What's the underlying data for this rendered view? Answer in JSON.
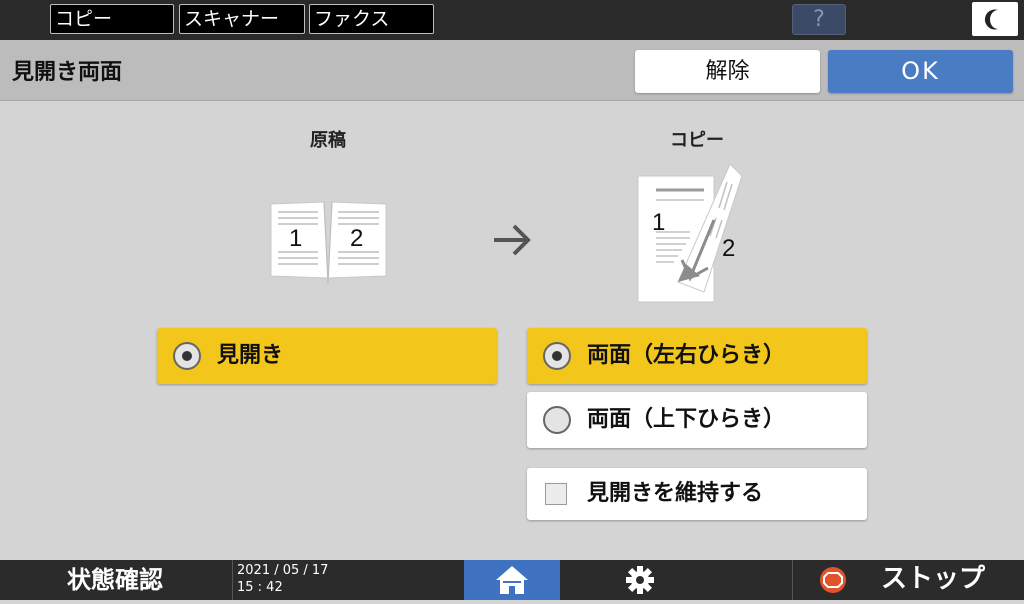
{
  "topbar": {
    "tabs": [
      {
        "label": "コピー"
      },
      {
        "label": "スキャナー"
      },
      {
        "label": "ファクス"
      }
    ],
    "help_label": "?"
  },
  "header": {
    "title": "見開き両面",
    "cancel_label": "解除",
    "ok_label": "OK"
  },
  "original": {
    "label": "原稿",
    "page_left": "1",
    "page_right": "2"
  },
  "copy": {
    "label": "コピー",
    "page_front": "1",
    "page_back": "2"
  },
  "options": {
    "original_mode": {
      "label": "見開き",
      "selected": true
    },
    "duplex_lr": {
      "label": "両面（左右ひらき）",
      "selected": true
    },
    "duplex_tb": {
      "label": "両面（上下ひらき）",
      "selected": false
    },
    "keep_spread": {
      "label": "見開きを維持する",
      "checked": false
    }
  },
  "bottombar": {
    "status_label": "状態確認",
    "date": "2021 / 05 / 17",
    "time": "15 : 42",
    "stop_label": "ストップ"
  },
  "colors": {
    "selected": "#f3c61c",
    "ok": "#4a7cc4",
    "home": "#3f72c0",
    "stop": "#e2532b"
  }
}
